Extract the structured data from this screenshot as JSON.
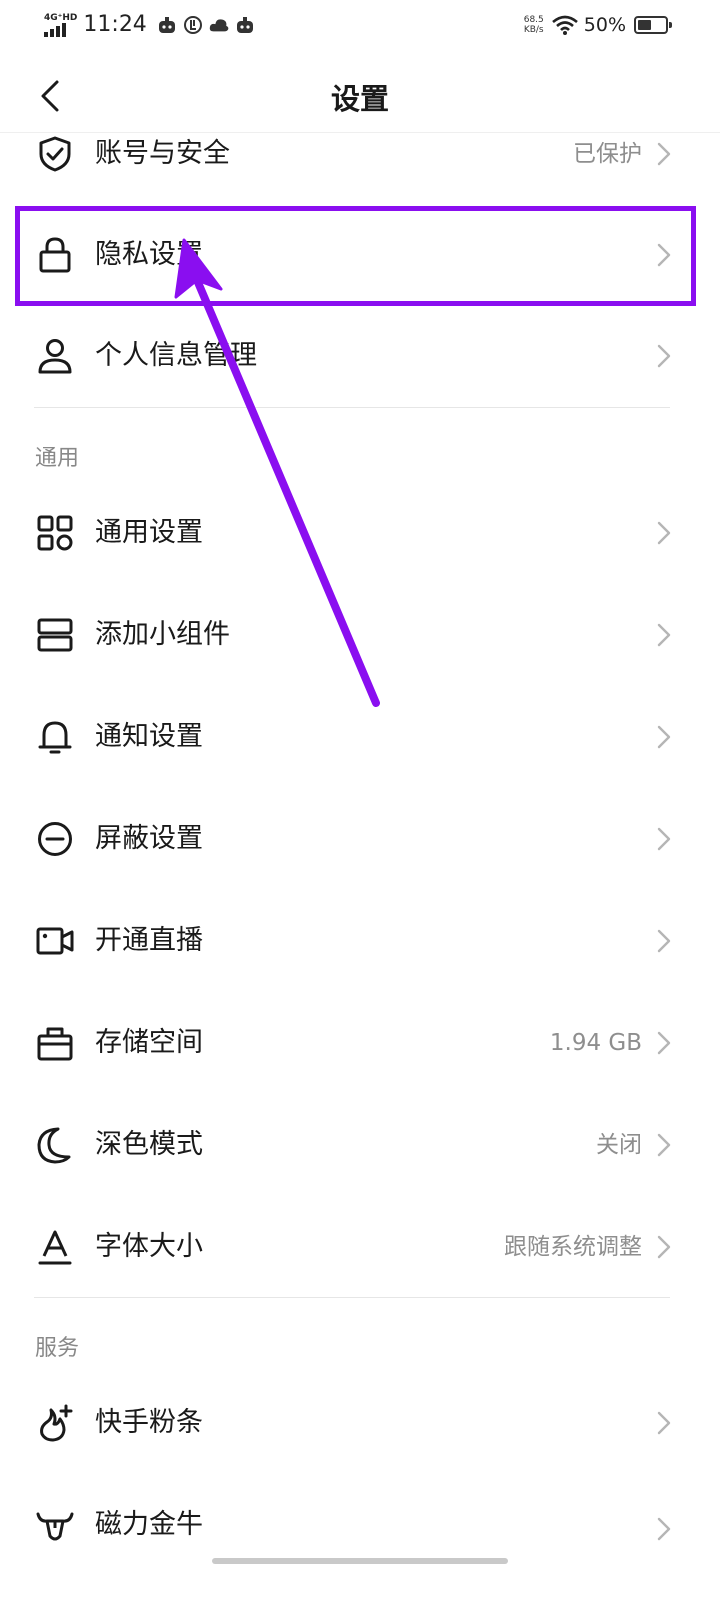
{
  "status_bar": {
    "network_type": "4G⁺HD",
    "time": "11:24",
    "speed_value": "68.5",
    "speed_unit": "KB/s",
    "battery": "50%",
    "battery_level": 0.5
  },
  "header": {
    "title": "设置"
  },
  "account_rows": [
    {
      "label": "账号与安全",
      "value": "已保护",
      "icon": "shield-check-icon"
    },
    {
      "label": "隐私设置",
      "value": "",
      "icon": "lock-icon"
    },
    {
      "label": "个人信息管理",
      "value": "",
      "icon": "person-icon"
    }
  ],
  "sections": {
    "general": "通用",
    "services": "服务"
  },
  "general_rows": [
    {
      "label": "通用设置",
      "value": "",
      "icon": "grid-icon"
    },
    {
      "label": "添加小组件",
      "value": "",
      "icon": "widget-icon"
    },
    {
      "label": "通知设置",
      "value": "",
      "icon": "bell-icon"
    },
    {
      "label": "屏蔽设置",
      "value": "",
      "icon": "block-icon"
    },
    {
      "label": "开通直播",
      "value": "",
      "icon": "video-camera-icon"
    },
    {
      "label": "存储空间",
      "value": "1.94 GB",
      "icon": "storage-box-icon"
    },
    {
      "label": "深色模式",
      "value": "关闭",
      "icon": "moon-icon"
    },
    {
      "label": "字体大小",
      "value": "跟随系统调整",
      "icon": "font-a-icon"
    }
  ],
  "service_rows": [
    {
      "label": "快手粉条",
      "value": "",
      "icon": "flame-plus-icon"
    },
    {
      "label": "磁力金牛",
      "value": "",
      "icon": "bull-icon"
    }
  ],
  "colors": {
    "highlight": "#8a0ef0",
    "secondary_text": "#8e8e8e",
    "chevron": "#b5b5b5"
  }
}
